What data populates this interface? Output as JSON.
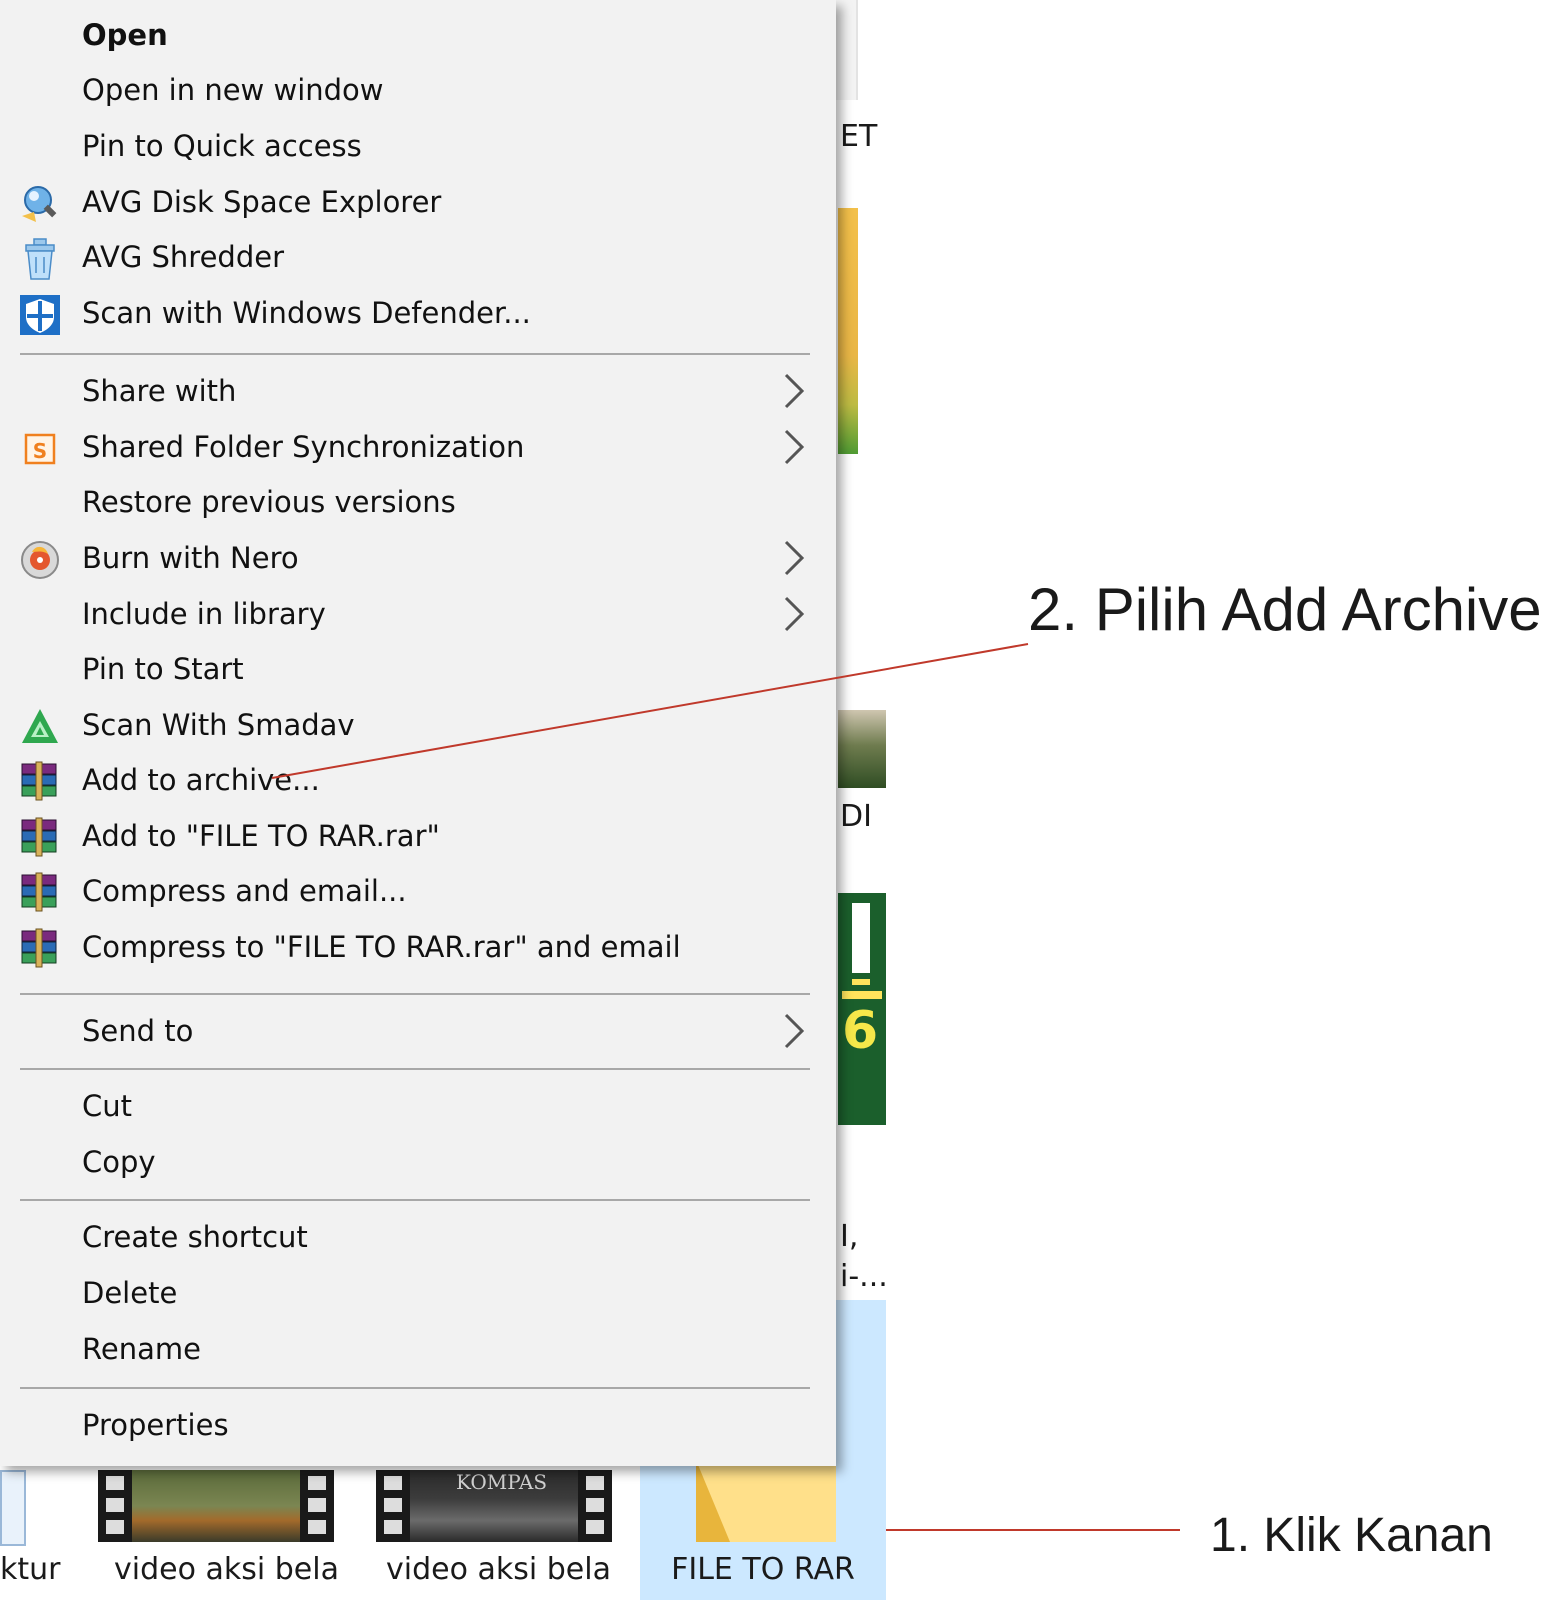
{
  "background": {
    "labels_right": [
      "ET",
      "DI",
      "I,",
      "i-..."
    ],
    "file_captions": [
      "ktur",
      "video aksi bela",
      "video aksi bela"
    ],
    "selected_folder_name": "FILE TO RAR",
    "thumb_text": "KOMPAS"
  },
  "context_menu": {
    "items": [
      {
        "label": "Open",
        "icon": "none",
        "submenu": false,
        "bold": true
      },
      {
        "label": "Open in new window",
        "icon": "none",
        "submenu": false
      },
      {
        "label": "Pin to Quick access",
        "icon": "none",
        "submenu": false
      },
      {
        "label": "AVG Disk Space Explorer",
        "icon": "avg-disk-icon",
        "submenu": false
      },
      {
        "label": "AVG Shredder",
        "icon": "avg-shredder-icon",
        "submenu": false
      },
      {
        "label": "Scan with Windows Defender...",
        "icon": "windows-defender-icon",
        "submenu": false
      },
      {
        "label": "Share with",
        "icon": "none",
        "submenu": true
      },
      {
        "label": "Shared Folder Synchronization",
        "icon": "sync-icon",
        "submenu": true
      },
      {
        "label": "Restore previous versions",
        "icon": "none",
        "submenu": false
      },
      {
        "label": "Burn with Nero",
        "icon": "nero-icon",
        "submenu": true
      },
      {
        "label": "Include in library",
        "icon": "none",
        "submenu": true
      },
      {
        "label": "Pin to Start",
        "icon": "none",
        "submenu": false
      },
      {
        "label": "Scan With Smadav",
        "icon": "smadav-icon",
        "submenu": false
      },
      {
        "label": "Add to archive...",
        "icon": "winrar-icon",
        "submenu": false
      },
      {
        "label": "Add to \"FILE TO RAR.rar\"",
        "icon": "winrar-icon",
        "submenu": false
      },
      {
        "label": "Compress and email...",
        "icon": "winrar-icon",
        "submenu": false
      },
      {
        "label": "Compress to \"FILE TO RAR.rar\" and email",
        "icon": "winrar-icon",
        "submenu": false
      },
      {
        "label": "Send to",
        "icon": "none",
        "submenu": true
      },
      {
        "label": "Cut",
        "icon": "none",
        "submenu": false
      },
      {
        "label": "Copy",
        "icon": "none",
        "submenu": false
      },
      {
        "label": "Create shortcut",
        "icon": "none",
        "submenu": false
      },
      {
        "label": "Delete",
        "icon": "none",
        "submenu": false
      },
      {
        "label": "Rename",
        "icon": "none",
        "submenu": false
      },
      {
        "label": "Properties",
        "icon": "none",
        "submenu": false
      }
    ]
  },
  "annotations": {
    "step2": "2. Pilih Add Archive",
    "step1": "1. Klik Kanan",
    "line_color": "#c0392b"
  },
  "colors": {
    "menu_bg": "#f2f2f2",
    "selection_bg": "#cce8ff",
    "separator": "#a8a8a8"
  }
}
